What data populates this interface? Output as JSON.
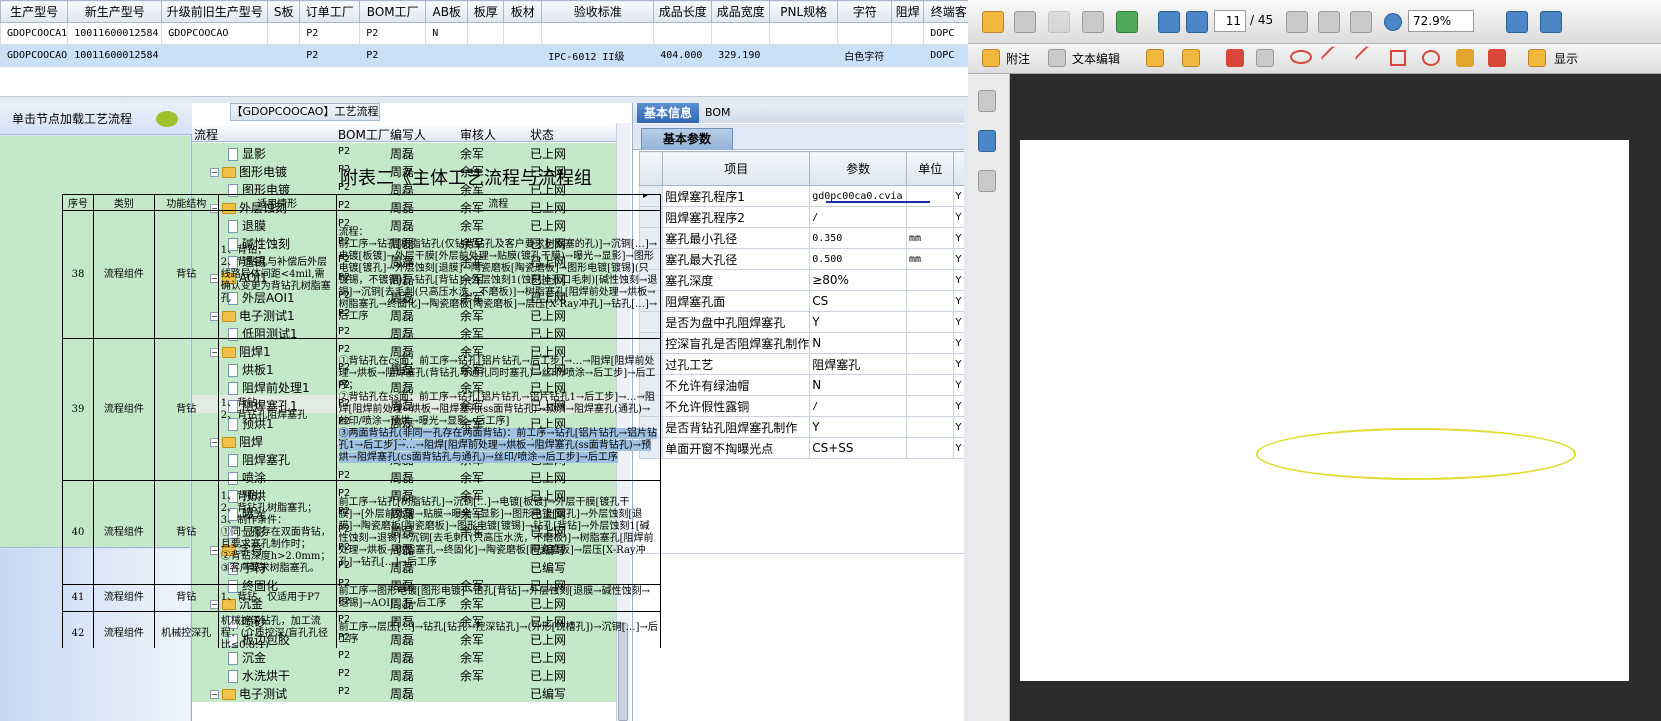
{
  "top_grid": {
    "headers": [
      "生产型号",
      "新生产型号",
      "升级前旧生产型号",
      "S板",
      "订单工厂",
      "BOM工厂",
      "AB板",
      "板厚",
      "板材",
      "验收标准",
      "成品长度",
      "成品宽度",
      "PNL规格",
      "字符",
      "阻焊",
      "终端客"
    ],
    "rows": [
      [
        "GDOPCOOCA1",
        "10011600012584",
        "GDOPCOOCAO",
        "",
        "P2",
        "P2",
        "N",
        "",
        "",
        "",
        "",
        "",
        "",
        "",
        "",
        "DOPC"
      ],
      [
        "GDOPCOOCAO",
        "10011600012584",
        "",
        "",
        "P2",
        "P2",
        "",
        "",
        "",
        "IPC-6012 II级",
        "404.000",
        "329.190",
        "",
        "白色字符",
        "",
        "DOPC"
      ]
    ]
  },
  "left_panel": {
    "title": "单击节点加载工艺流程"
  },
  "tree": {
    "title": "【GDOPCOOCAO】工艺流程",
    "headers": [
      "流程",
      "BOM工厂",
      "编写人",
      "审核人",
      "状态"
    ],
    "rows": [
      {
        "name": "显影",
        "type": "doc",
        "level": 2,
        "bom": "P2",
        "author": "周磊",
        "reviewer": "余军",
        "status": "已上网"
      },
      {
        "name": "图形电镀",
        "type": "folder",
        "level": 1,
        "bom": "P2",
        "author": "周磊",
        "reviewer": "余军",
        "status": "已上网"
      },
      {
        "name": "图形电镀",
        "type": "doc",
        "level": 2,
        "bom": "P2",
        "author": "周磊",
        "reviewer": "余军",
        "status": "已上网"
      },
      {
        "name": "外层蚀刻",
        "type": "folder",
        "level": 1,
        "bom": "P2",
        "author": "周磊",
        "reviewer": "余军",
        "status": "已上网"
      },
      {
        "name": "退膜",
        "type": "doc",
        "level": 2,
        "bom": "P2",
        "author": "周磊",
        "reviewer": "余军",
        "status": "已上网"
      },
      {
        "name": "碱性蚀刻",
        "type": "doc",
        "level": 2,
        "bom": "P2",
        "author": "周磊",
        "reviewer": "余军",
        "status": "已上网"
      },
      {
        "name": "退锡",
        "type": "doc",
        "level": 2,
        "bom": "P2",
        "author": "周磊",
        "reviewer": "余军",
        "status": "已上网"
      },
      {
        "name": "AOI1",
        "type": "folder",
        "level": 1,
        "bom": "P2",
        "author": "周磊",
        "reviewer": "余军",
        "status": "已上网"
      },
      {
        "name": "外层AOI1",
        "type": "doc",
        "level": 2,
        "bom": "P2",
        "author": "周磊",
        "reviewer": "余军",
        "status": "已上网"
      },
      {
        "name": "电子测试1",
        "type": "folder",
        "level": 1,
        "bom": "P2",
        "author": "周磊",
        "reviewer": "余军",
        "status": "已上网"
      },
      {
        "name": "低阻测试1",
        "type": "doc",
        "level": 2,
        "bom": "P2",
        "author": "周磊",
        "reviewer": "余军",
        "status": "已上网"
      },
      {
        "name": "阻焊1",
        "type": "folder",
        "level": 1,
        "bom": "P2",
        "author": "周磊",
        "reviewer": "余军",
        "status": "已上网"
      },
      {
        "name": "烘板1",
        "type": "doc",
        "level": 2,
        "bom": "P2",
        "author": "周磊",
        "reviewer": "余军",
        "status": "已上网"
      },
      {
        "name": "阻焊前处理1",
        "type": "doc",
        "level": 2,
        "bom": "P2",
        "author": "周磊",
        "reviewer": "余军",
        "status": "已上网"
      },
      {
        "name": "阻焊塞孔1",
        "type": "doc",
        "level": 2,
        "bom": "P2",
        "author": "周磊",
        "reviewer": "余军",
        "status": "已上网",
        "selected": true
      },
      {
        "name": "预烘1",
        "type": "doc",
        "level": 2,
        "bom": "P2",
        "author": "周磊",
        "reviewer": "余军",
        "status": "已上网"
      },
      {
        "name": "阻焊",
        "type": "folder",
        "level": 1,
        "bom": "P2",
        "author": "周磊",
        "reviewer": "余军",
        "status": "已上网"
      },
      {
        "name": "阻焊塞孔",
        "type": "doc",
        "level": 2,
        "bom": "P2",
        "author": "周磊",
        "reviewer": "余军",
        "status": "已上网"
      },
      {
        "name": "喷涂",
        "type": "doc",
        "level": 2,
        "bom": "P2",
        "author": "周磊",
        "reviewer": "余军",
        "status": "已上网"
      },
      {
        "name": "预烘",
        "type": "doc",
        "level": 2,
        "bom": "P2",
        "author": "周磊",
        "reviewer": "余军",
        "status": "已上网"
      },
      {
        "name": "曝光",
        "type": "doc",
        "level": 2,
        "bom": "P2",
        "author": "周磊",
        "reviewer": "余军",
        "status": "已上网"
      },
      {
        "name": "显影",
        "type": "doc",
        "level": 2,
        "bom": "P2",
        "author": "周磊",
        "reviewer": "余军",
        "status": "已上网"
      },
      {
        "name": "字符",
        "type": "folder",
        "level": 1,
        "bom": "P2",
        "author": "周磊",
        "reviewer": "",
        "status": "已编写"
      },
      {
        "name": "字符",
        "type": "doc",
        "level": 2,
        "bom": "P2",
        "author": "周磊",
        "reviewer": "",
        "status": "已编写"
      },
      {
        "name": "终固化",
        "type": "doc",
        "level": 2,
        "bom": "P2",
        "author": "周磊",
        "reviewer": "余军",
        "status": "已上网"
      },
      {
        "name": "沉金",
        "type": "folder",
        "level": 1,
        "bom": "P2",
        "author": "周磊",
        "reviewer": "余军",
        "status": "已上网"
      },
      {
        "name": "喷砂",
        "type": "doc",
        "level": 2,
        "bom": "P2",
        "author": "周磊",
        "reviewer": "余军",
        "status": "已上网"
      },
      {
        "name": "板边包胶",
        "type": "doc",
        "level": 2,
        "bom": "P2",
        "author": "周磊",
        "reviewer": "余军",
        "status": "已上网"
      },
      {
        "name": "沉金",
        "type": "doc",
        "level": 2,
        "bom": "P2",
        "author": "周磊",
        "reviewer": "余军",
        "status": "已上网"
      },
      {
        "name": "水洗烘干",
        "type": "doc",
        "level": 2,
        "bom": "P2",
        "author": "周磊",
        "reviewer": "余军",
        "status": "已上网"
      },
      {
        "name": "电子测试",
        "type": "folder",
        "level": 1,
        "bom": "P2",
        "author": "周磊",
        "reviewer": "",
        "status": "已编写"
      }
    ]
  },
  "base_info": {
    "tab_active": "基本信息",
    "tab_other": "BOM",
    "subtab": "基本参数",
    "headers": [
      "项目",
      "参数",
      "单位"
    ],
    "rows": [
      {
        "item": "阻焊塞孔程序1",
        "value": "gd0pc00ca0.cvia",
        "unit": "",
        "flag": "Y",
        "current": true
      },
      {
        "item": "阻焊塞孔程序2",
        "value": "/",
        "unit": "",
        "flag": "Y"
      },
      {
        "item": "塞孔最小孔径",
        "value": "0.350",
        "unit": "mm",
        "flag": "Y"
      },
      {
        "item": "塞孔最大孔径",
        "value": "0.500",
        "unit": "mm",
        "flag": "Y"
      },
      {
        "item": "塞孔深度",
        "value": "≥80%",
        "unit": "",
        "flag": "Y"
      },
      {
        "item": "阻焊塞孔面",
        "value": "CS",
        "unit": "",
        "flag": "Y"
      },
      {
        "item": "是否为盘中孔阻焊塞孔",
        "value": "Y",
        "unit": "",
        "flag": "Y"
      },
      {
        "item": "控深盲孔是否阻焊塞孔制作",
        "value": "N",
        "unit": "",
        "flag": "Y"
      },
      {
        "item": "过孔工艺",
        "value": "阻焊塞孔",
        "unit": "",
        "flag": "Y"
      },
      {
        "item": "不允许有绿油帽",
        "value": "N",
        "unit": "",
        "flag": "Y"
      },
      {
        "item": "不允许假性露铜",
        "value": "/",
        "unit": "",
        "flag": "Y"
      },
      {
        "item": "是否背钻孔阻焊塞孔制作",
        "value": "Y",
        "unit": "",
        "flag": "Y"
      },
      {
        "item": "单面开窗不掏曝光点",
        "value": "CS+SS",
        "unit": "",
        "flag": "Y"
      }
    ]
  },
  "pdf": {
    "page_current": "11",
    "page_total": "/ 45",
    "zoom": "72.9%",
    "toolbar2": {
      "note": "附注",
      "text_edit": "文本编辑",
      "display": "显示"
    },
    "doc_title": "附表二《主体工艺流程与流程组",
    "doc_headers": [
      "序号",
      "类别",
      "功能结构",
      "适用情形",
      "流程"
    ],
    "doc_rows": [
      {
        "no": "38",
        "cat": "流程组件",
        "func": "背钻",
        "case": "1、背钻；\n2、背钻孔与补偿后外层线路导体间距<4mil,需确认变更为背钻孔树脂塞孔",
        "flow": "流程：\n前工序→钻孔[树脂钻孔(仅钻背钻孔及客户要求树脂塞的孔)]→沉铜[…]→电镀[板镀]→外层干膜[外层前处理→贴膜(镀孔干膜)→曝光→显影]→图形电镀[镀孔]→外层蚀刻[退膜]→陶瓷磨板[陶瓷磨板]→图形电镀[镀锡](只镀锡，不镀铜)]→钻孔[背钻]→外层蚀刻1(蚀刻掉孔口毛刺)[碱性蚀刻→退锡]→沉铜[去毛刺(只高压水洗，不磨板)]→树脂塞孔[阻焊前处理→烘板→树脂塞孔→终固化]→陶瓷磨板[陶瓷磨板]→层压[X-Ray冲孔]→钻孔[…]→后工序"
      },
      {
        "no": "39",
        "cat": "流程组件",
        "func": "背钻",
        "case": "1、背钻；\n2、背钻孔阻焊塞孔",
        "flow_plain": "①背钻孔在cs面：前工序→钻孔[铝片钻孔→后工步]→…→阻焊[阻焊前处理→烘板→阻焊塞孔(背钻孔与通孔同时塞孔)→丝印/喷涂→后工步]→后工序；\n②背钻孔在ss面：前工序→钻孔[铝片钻孔→铝片钻孔1→后工步]→…→阻焊[阻焊前处理→烘板→阻焊塞孔(ss面背钻孔)→预烘→阻焊塞孔(通孔)→丝印/喷涂→预烘→曝光→显影→后工序]\n",
        "flow_hl": "③两面背钻孔(非同一孔存在两面背钻)：前工序→钻孔[铝片钻孔→铝片钻孔1→后工步]→…→阻焊[阻焊前处理→烘板→阻焊塞孔(ss面背钻孔)→预烘→阻焊塞孔(cs面背钻孔与通孔)→丝印/喷涂→后工步]→后工序"
      },
      {
        "no": "40",
        "cat": "流程组件",
        "func": "背钻",
        "case": "1、背钻；\n2、背钻孔树脂塞孔；\n3、制作条件：\n①同一孔存在双面背钻，且要求塞孔制作时；\n②背钻深度h>2.0mm；\n③客户要求树脂塞孔。",
        "flow": "前工序→钻孔[树脂钻孔]→沉铜[…]→电镀[板镀]→外层干膜[镀孔干膜]→[外层前处理→贴膜→曝光→显影]→图形电镀[镀孔]→外层蚀刻[退膜]→陶瓷磨板[陶瓷磨板]→图形电镀[镀锡]→钻孔[背钻]→外层蚀刻1[碱性蚀刻→退锡]→沉铜[去毛刺1(只高压水洗，不磨板)]→树脂塞孔[阻焊前处理→烘板→树脂塞孔→终固化]→陶瓷磨板[陶瓷磨板]→层压[X-Ray冲孔]→钻孔[…]→后工序"
      },
      {
        "no": "41",
        "cat": "流程组件",
        "func": "背钻",
        "case": "1、背钻，仅适用于P7",
        "flow": "前工序→图形电镀[图形电镀]→钻孔[背钻]→外层蚀刻[退膜→碱性蚀刻→退锡]→AOI[…]→后工序"
      },
      {
        "no": "42",
        "cat": "流程组件",
        "func": "机械控深孔",
        "case": "机械控深钻孔，加工流程：(介质控深/盲孔孔径比≤0.8:1)",
        "flow": "前工序→层压[…]→钻孔[钻孔→控深钻孔]→(外形[铣槽孔])→沉铜[…]→后工序"
      }
    ]
  }
}
